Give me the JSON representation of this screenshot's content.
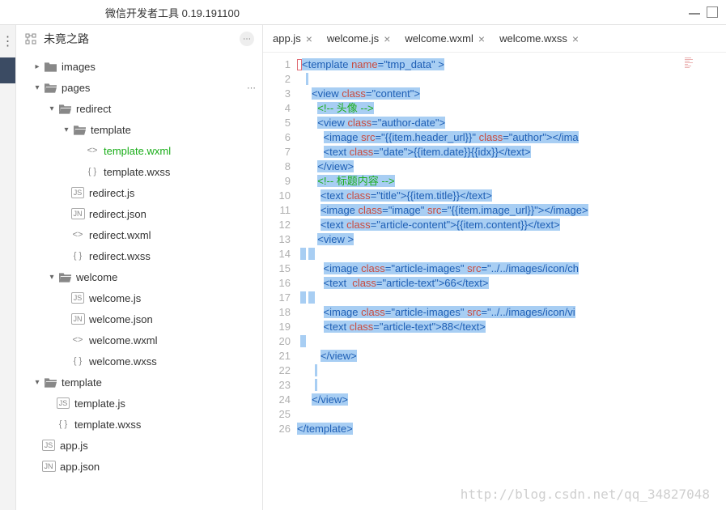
{
  "title": "微信开发者工具 0.19.191100",
  "project_name": "未竟之路",
  "tree": {
    "images": "images",
    "pages": "pages",
    "redirect": "redirect",
    "template_folder": "template",
    "template_wxml": "template.wxml",
    "template_wxss": "template.wxss",
    "redirect_js": "redirect.js",
    "redirect_json": "redirect.json",
    "redirect_wxml": "redirect.wxml",
    "redirect_wxss": "redirect.wxss",
    "welcome": "welcome",
    "welcome_js": "welcome.js",
    "welcome_json": "welcome.json",
    "welcome_wxml": "welcome.wxml",
    "welcome_wxss": "welcome.wxss",
    "template2": "template",
    "template2_js": "template.js",
    "template2_wxss": "template.wxss",
    "app_js": "app.js",
    "app_json": "app.json"
  },
  "tabs": {
    "t1": "app.js",
    "t2": "welcome.js",
    "t3": "welcome.wxml",
    "t4": "welcome.wxss"
  },
  "code": {
    "l1a": "<template",
    "l1b": " name",
    "l1c": "=",
    "l1d": "\"tmp_data\"",
    "l1e": " >",
    "l3a": "<view",
    "l3b": " class",
    "l3c": "=\"content\"",
    "l3d": ">",
    "l4": "<!-- 头像 -->",
    "l5a": "<view",
    "l5b": " class",
    "l5c": "=\"author-date\"",
    "l5d": ">",
    "l6a": "<image",
    "l6b": " src",
    "l6c": "=\"{{item.header_url}}\"",
    "l6d": " class",
    "l6e": "=\"author\"",
    "l6f": "></ima",
    "l7a": "<text",
    "l7b": " class",
    "l7c": "=\"date\"",
    "l7d": ">{{item.date}}{{idx}}</text>",
    "l8": "</view>",
    "l9": "<!-- 标题内容 -->",
    "l10a": "<text",
    "l10b": " class",
    "l10c": "=\"title\"",
    "l10d": ">{{item.title}}</text>",
    "l11a": "<image",
    "l11b": " class",
    "l11c": "=\"image\"",
    "l11d": " src",
    "l11e": "=\"{{item.image_url}}\"",
    "l11f": "></image>",
    "l12a": "<text",
    "l12b": " class",
    "l12c": "=\"article-content\"",
    "l12d": ">{{item.content}}</text>",
    "l13": "<view >",
    "l15a": "<image",
    "l15b": " class",
    "l15c": "=\"article-images\"",
    "l15d": " src",
    "l15e": "=\"../../images/icon/ch",
    "l16a": "<text ",
    "l16b": " class",
    "l16c": "=\"article-text\"",
    "l16d": ">66</text>",
    "l18a": "<image",
    "l18b": " class",
    "l18c": "=\"article-images\"",
    "l18d": " src",
    "l18e": "=\"../../images/icon/vi",
    "l19a": "<text",
    "l19b": " class",
    "l19c": "=\"article-text\"",
    "l19d": ">88</text>",
    "l21": "</view>",
    "l24": "</view>",
    "l26": "</template>"
  },
  "watermark": "http://blog.csdn.net/qq_34827048"
}
